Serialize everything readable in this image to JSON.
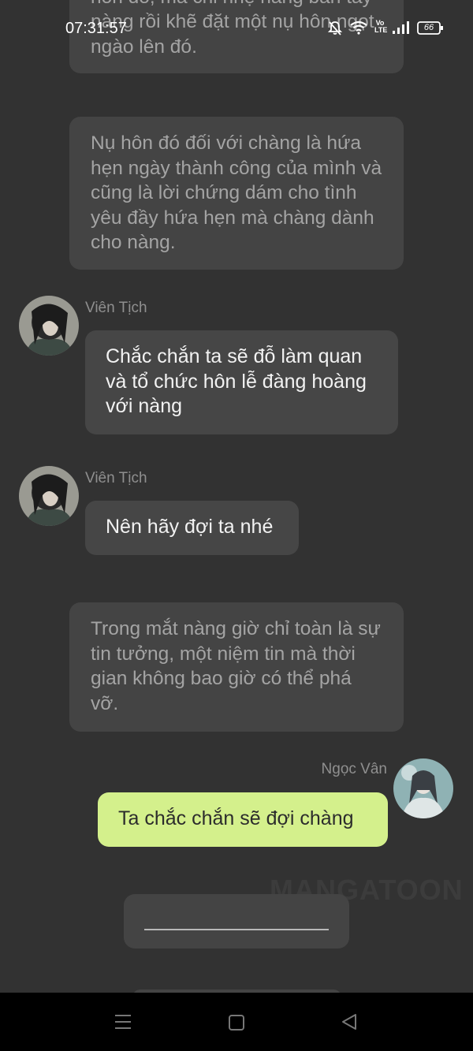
{
  "status_bar": {
    "time": "07:31:57",
    "battery": "66"
  },
  "chat": {
    "narration_top": "hôn đó, mà chỉ nhẹ nâng bàn tay nàng rồi khẽ đặt một nụ hôn ngọt ngào lên đó.",
    "narration_1": "Nụ hôn đó đối với chàng là hứa hẹn ngày thành công của mình và cũng là lời chứng dám cho tình yêu đầy hứa hẹn mà chàng dành cho nàng.",
    "message_1": {
      "speaker": "Viên Tịch",
      "text": "Chắc chắn ta sẽ đỗ làm quan và tổ chức hôn lễ đàng hoàng với nàng"
    },
    "message_2": {
      "speaker": "Viên Tịch",
      "text": "Nên hãy đợi ta nhé"
    },
    "narration_2": "Trong mắt nàng giờ chỉ toàn là sự tin tưởng, một niệm tin mà thời gian không bao giờ có thể phá vỡ.",
    "message_3": {
      "speaker": "Ngọc Vân",
      "text": "Ta chắc chắn sẽ đợi chàng"
    }
  },
  "watermark": "MANGATOON",
  "colors": {
    "background": "#323232",
    "bubble": "#444444",
    "own_bubble": "#d4f08c",
    "navbar": "#000000"
  },
  "icons": {
    "dnd": "bell-off-icon",
    "wifi": "wifi-icon",
    "volte": "volte-icon",
    "signal": "signal-icon",
    "battery": "battery-icon",
    "nav_menu": "menu-icon",
    "nav_home": "home-icon",
    "nav_back": "back-icon"
  }
}
